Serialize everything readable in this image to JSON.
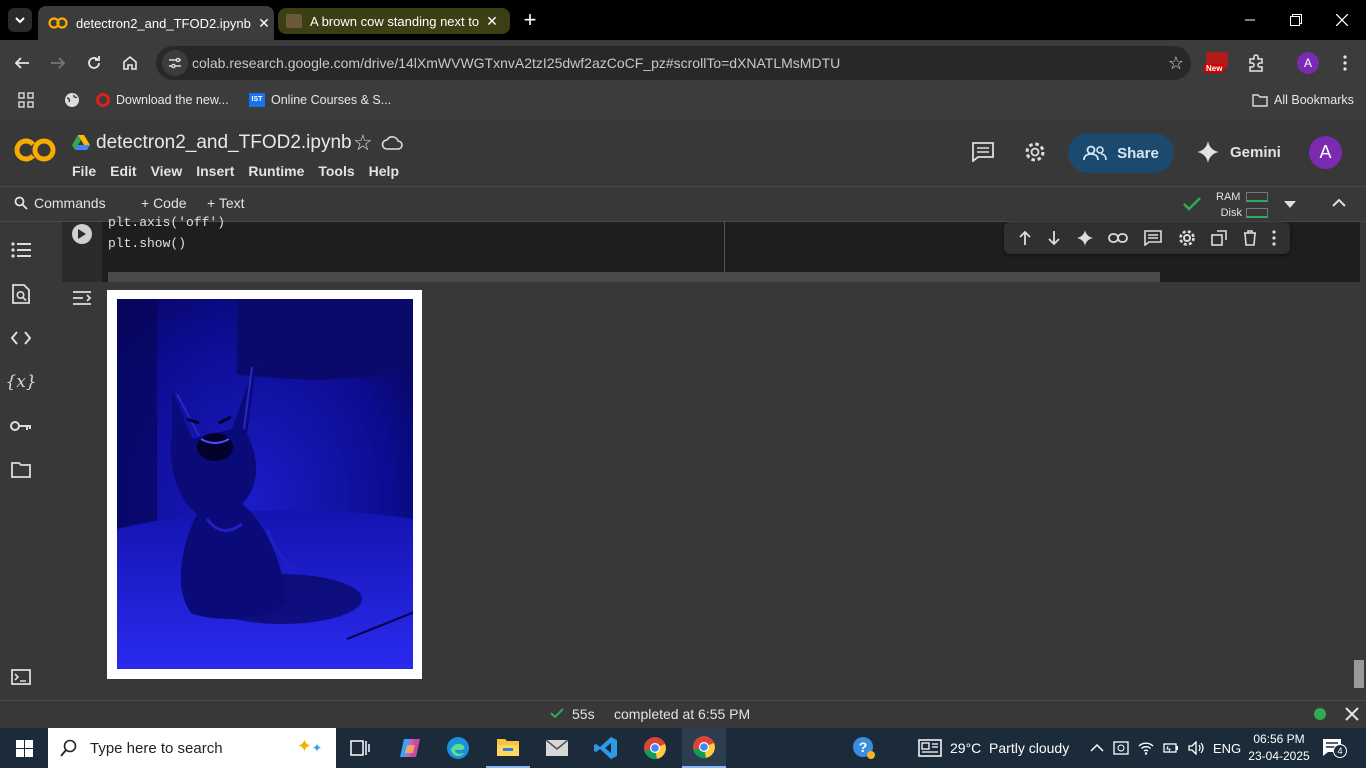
{
  "browser": {
    "tabs": [
      {
        "title": "detectron2_and_TFOD2.ipynb -",
        "active": true
      },
      {
        "title": "A brown cow standing next to a",
        "active": false
      }
    ],
    "url": "colab.research.google.com/drive/14lXmWVWGTxnvA2tzI25dwf2azCoCF_pz#scrollTo=dXNATLMsMDTU",
    "profile_initial": "A",
    "new_badge": "New",
    "bookmarks": [
      {
        "label": "Download the new...",
        "icon": "opera-icon"
      },
      {
        "label": "Online Courses & S...",
        "icon": "ist-icon",
        "badge": "IST"
      }
    ],
    "all_bookmarks": "All Bookmarks"
  },
  "colab": {
    "logo": "CO",
    "notebook_name": "detectron2_and_TFOD2.ipynb",
    "menu": [
      "File",
      "Edit",
      "View",
      "Insert",
      "Runtime",
      "Tools",
      "Help"
    ],
    "share_label": "Share",
    "gemini_label": "Gemini",
    "avatar_initial": "A",
    "commands_label": "Commands",
    "add_code_label": "+ Code",
    "add_text_label": "+ Text",
    "ram_label": "RAM",
    "disk_label": "Disk"
  },
  "cell": {
    "code_lines": [
      "plt.axis('off')",
      "plt.show()"
    ]
  },
  "status": {
    "duration": "55s",
    "completed": "completed at 6:55 PM"
  },
  "taskbar": {
    "search_placeholder": "Type here to search",
    "weather": "29°C  Partly cloudy",
    "language": "ENG",
    "time": "06:56 PM",
    "date": "23-04-2025",
    "notification_count": "4"
  },
  "colors": {
    "accent_blue": "#0b57d0",
    "colab_orange": "#f9ab00",
    "success_green": "#34a853",
    "share_bg": "#1c4a6e"
  }
}
